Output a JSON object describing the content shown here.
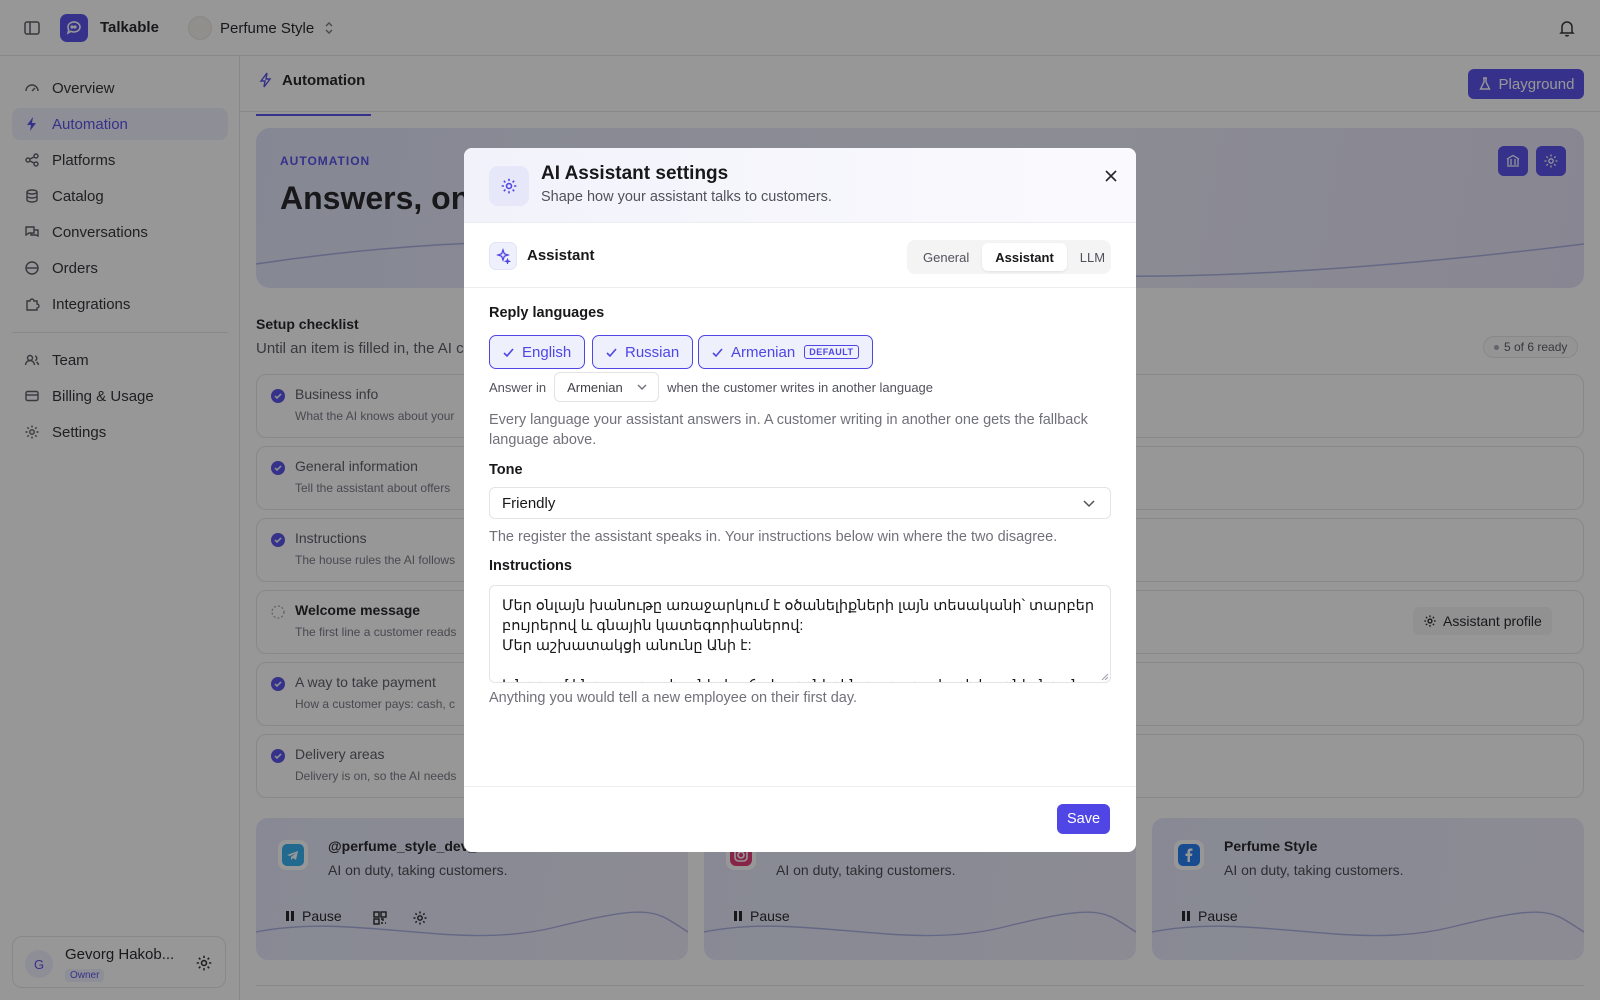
{
  "app": {
    "name": "Talkable",
    "workspace": "Perfume Style"
  },
  "sidebar": {
    "items": [
      {
        "label": "Overview"
      },
      {
        "label": "Automation"
      },
      {
        "label": "Platforms"
      },
      {
        "label": "Catalog"
      },
      {
        "label": "Conversations"
      },
      {
        "label": "Orders"
      },
      {
        "label": "Integrations"
      },
      {
        "label": "Team"
      },
      {
        "label": "Billing & Usage"
      },
      {
        "label": "Settings"
      }
    ],
    "active": "Automation",
    "user": {
      "initial": "G",
      "name": "Gevorg Hakob...",
      "role": "Owner"
    }
  },
  "header": {
    "tab": "Automation",
    "playground_label": "Playground"
  },
  "hero": {
    "kicker": "AUTOMATION",
    "title": "Answers, on a"
  },
  "setup": {
    "title": "Setup checklist",
    "subtitle": "Until an item is filled in, the AI c",
    "ready": "5 of 6 ready",
    "items": [
      {
        "title": "Business info",
        "sub": "What the AI knows about your",
        "done": true
      },
      {
        "title": "General information",
        "sub": "Tell the assistant about offers",
        "done": true
      },
      {
        "title": "Instructions",
        "sub": "The house rules the AI follows",
        "done": true
      },
      {
        "title": "Welcome message",
        "sub": "The first line a customer reads",
        "done": false
      },
      {
        "title": "A way to take payment",
        "sub": "How a customer pays: cash, c",
        "done": true
      },
      {
        "title": "Delivery areas",
        "sub": "Delivery is on, so the AI needs",
        "done": true
      }
    ],
    "assistant_profile_label": "Assistant profile"
  },
  "channels": [
    {
      "name": "@perfume_style_dev_",
      "status": "AI on duty, taking customers.",
      "pause": "Pause",
      "icon": "telegram-icon",
      "color": "#2aabee"
    },
    {
      "name": "",
      "status": "AI on duty, taking customers.",
      "pause": "Pause",
      "icon": "instagram-icon",
      "color": "#e1306c"
    },
    {
      "name": "Perfume Style",
      "status": "AI on duty, taking customers.",
      "pause": "Pause",
      "icon": "facebook-icon",
      "color": "#1877f2"
    }
  ],
  "modal": {
    "title": "AI Assistant settings",
    "subtitle": "Shape how your assistant talks to customers.",
    "section": "Assistant",
    "tabs": [
      "General",
      "Assistant",
      "LLM"
    ],
    "active_tab": "Assistant",
    "reply_languages_label": "Reply languages",
    "languages": [
      {
        "label": "English"
      },
      {
        "label": "Russian"
      },
      {
        "label": "Armenian",
        "badge": "DEFAULT"
      }
    ],
    "answer_in_prefix": "Answer in",
    "answer_in_value": "Armenian",
    "answer_in_suffix": "when the customer writes in another language",
    "languages_help": "Every language your assistant answers in. A customer writing in another one gets the fallback language above.",
    "tone_label": "Tone",
    "tone_value": "Friendly",
    "tone_help": "The register the assistant speaks in. Your instructions below win where the two disagree.",
    "instructions_label": "Instructions",
    "instructions_value": "Մեր օնլայն խանութը առաջարկում է օծանելիքների լայն տեսականի՝ տարբեր բույրերով և գնային կատեգորիաներով:\nՄեր աշխատակցի անունը Անի է:\n\nԽնդրում ենք պատասխանել հաճախորդներին քաղաքավարի և օգնել նրանց",
    "instructions_help": "Anything you would tell a new employee on their first day.",
    "save_label": "Save"
  },
  "colors": {
    "accent": "#4f46e5",
    "accent_soft": "#eef0fb"
  }
}
